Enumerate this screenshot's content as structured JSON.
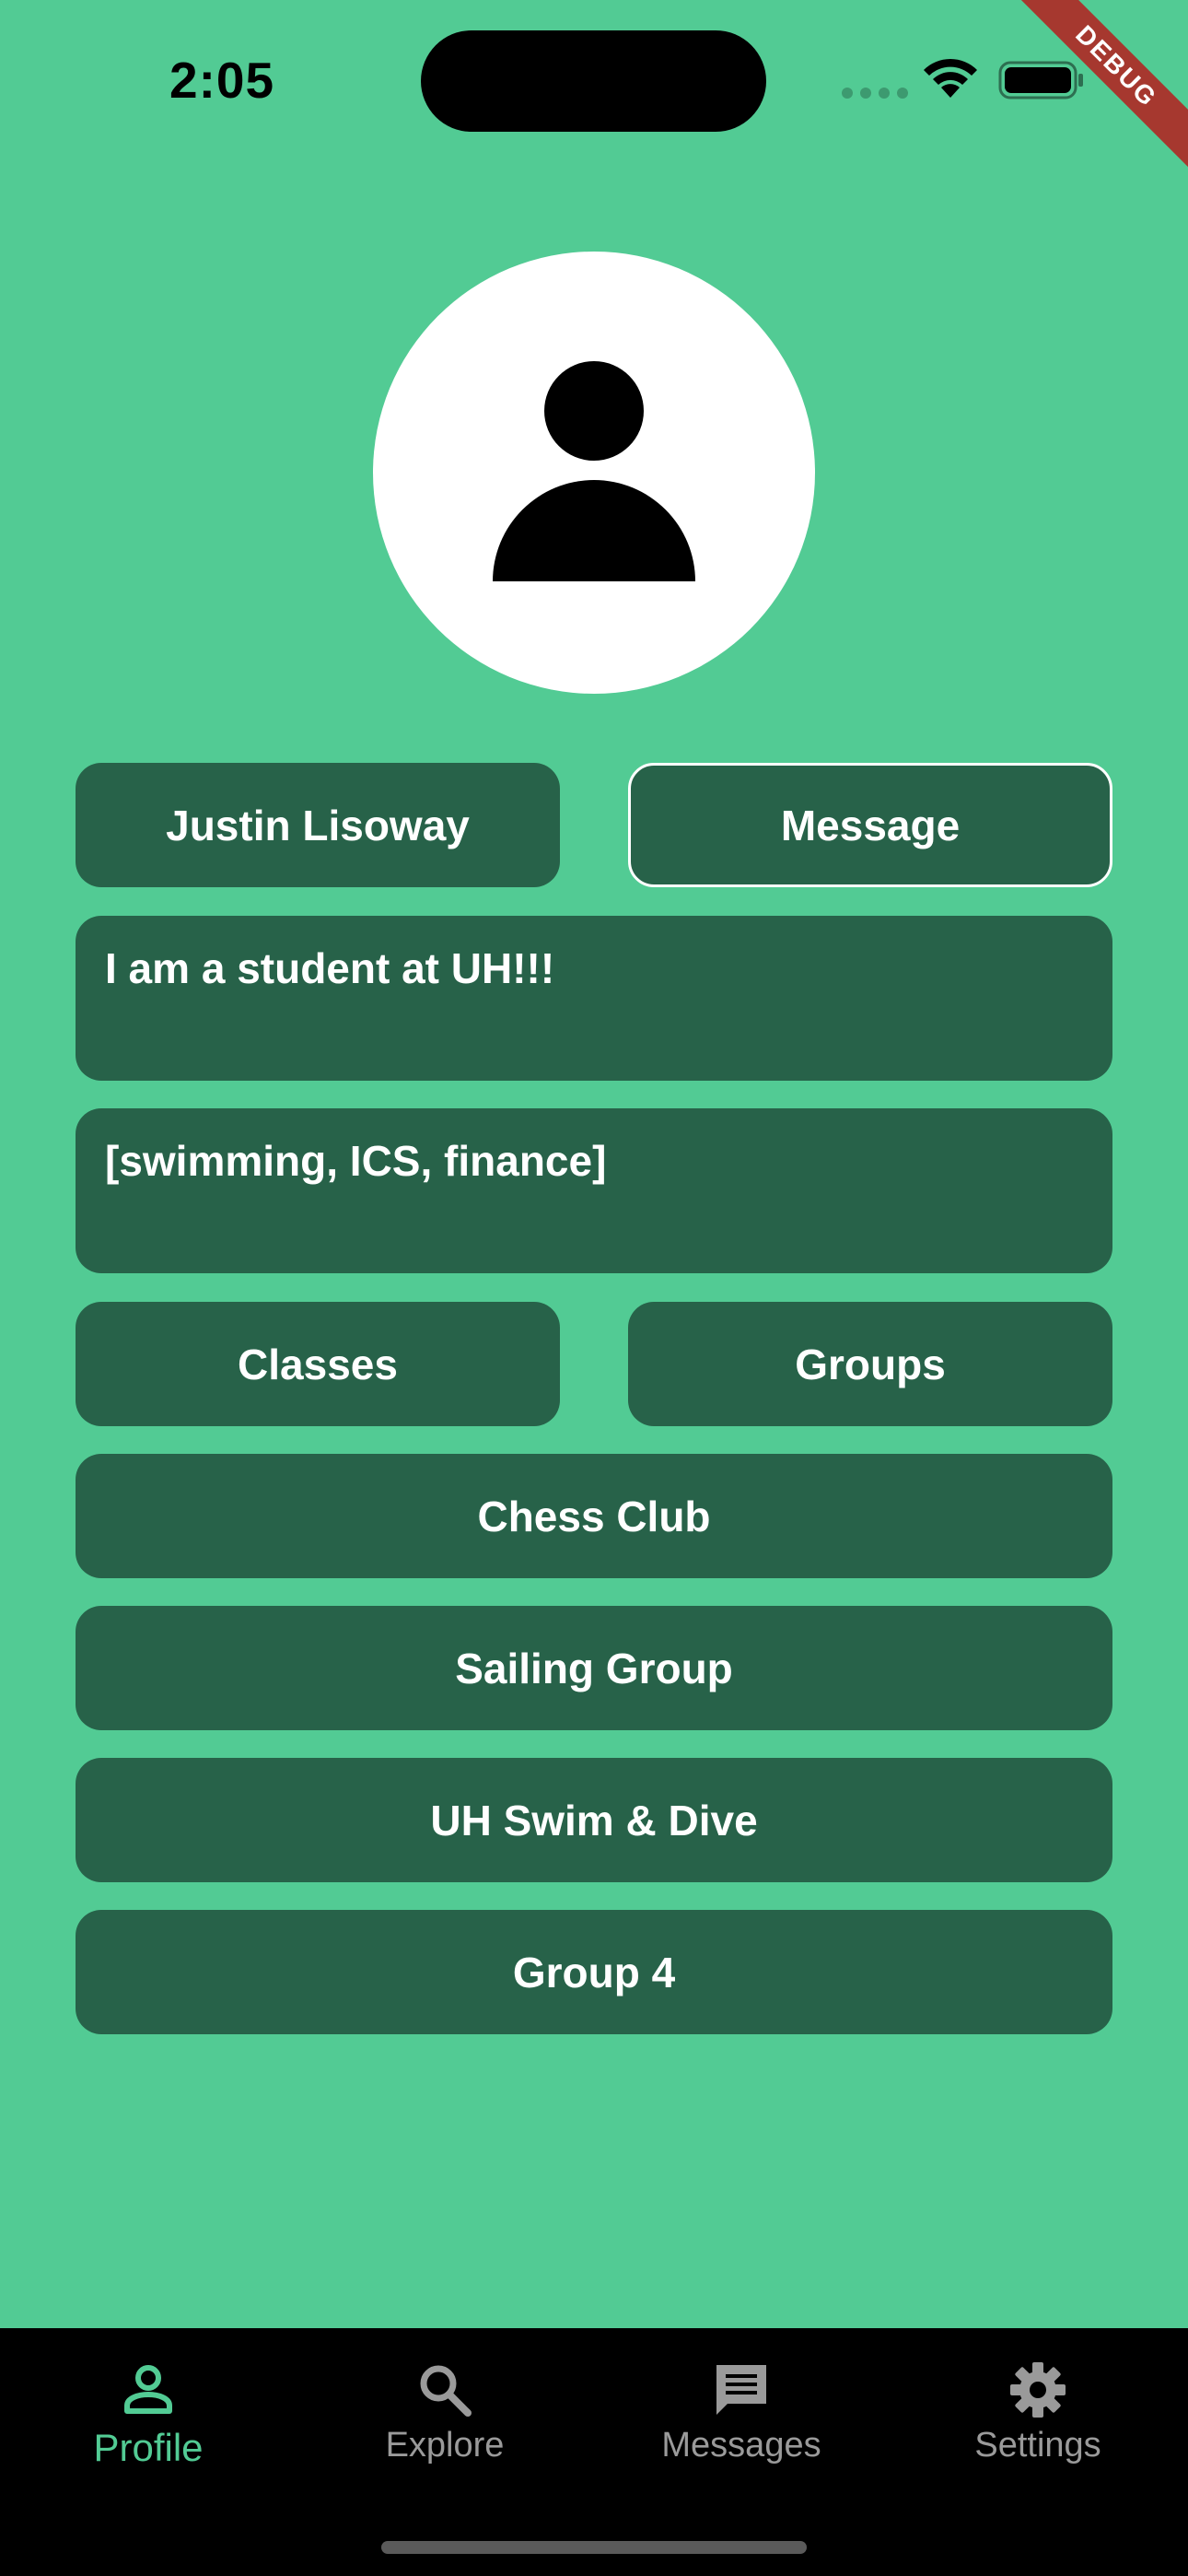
{
  "status_bar": {
    "time": "2:05",
    "debug_label": "DEBUG"
  },
  "profile": {
    "name": "Justin Lisoway",
    "message_label": "Message",
    "bio": "I am a student at UH!!!",
    "interests": "[swimming, ICS, finance]",
    "classes_label": "Classes",
    "groups_label": "Groups",
    "groups": [
      "Chess Club",
      "Sailing Group",
      "UH Swim & Dive",
      "Group 4"
    ]
  },
  "bottom_nav": {
    "items": [
      {
        "label": "Profile",
        "icon": "person-icon",
        "active": true
      },
      {
        "label": "Explore",
        "icon": "search-icon",
        "active": false
      },
      {
        "label": "Messages",
        "icon": "chat-icon",
        "active": false
      },
      {
        "label": "Settings",
        "icon": "gear-icon",
        "active": false
      }
    ]
  },
  "colors": {
    "background": "#52CB94",
    "button": "#276249",
    "nav_background": "#000000",
    "nav_active": "#52CB94",
    "nav_inactive": "#9A9A9A",
    "debug_ribbon": "#A6382F"
  }
}
